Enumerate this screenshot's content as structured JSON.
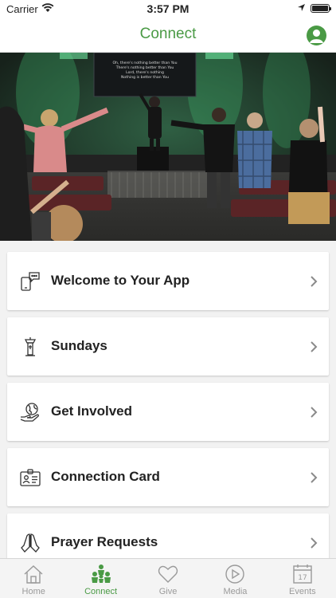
{
  "status_bar": {
    "carrier": "Carrier",
    "time": "3:57 PM"
  },
  "header": {
    "title": "Connect"
  },
  "hero": {
    "slide_lines": [
      "Oh, there's nothing better than You",
      "There's nothing better than You",
      "Lord, there's nothing",
      "Nothing is better than You"
    ]
  },
  "menu": {
    "items": [
      {
        "label": "Welcome to Your App",
        "icon": "phone-chat-icon"
      },
      {
        "label": "Sundays",
        "icon": "pulpit-icon"
      },
      {
        "label": "Get Involved",
        "icon": "globe-hand-icon"
      },
      {
        "label": "Connection Card",
        "icon": "id-card-icon"
      },
      {
        "label": "Prayer Requests",
        "icon": "praying-hands-icon"
      }
    ]
  },
  "tabbar": {
    "tabs": [
      {
        "label": "Home",
        "icon": "home-icon",
        "active": false
      },
      {
        "label": "Connect",
        "icon": "people-icon",
        "active": true
      },
      {
        "label": "Give",
        "icon": "heart-icon",
        "active": false
      },
      {
        "label": "Media",
        "icon": "play-icon",
        "active": false
      },
      {
        "label": "Events",
        "icon": "calendar-icon",
        "active": false,
        "date": "17"
      }
    ]
  },
  "colors": {
    "accent": "#4a9a45",
    "inactive": "#9a9a9a"
  }
}
